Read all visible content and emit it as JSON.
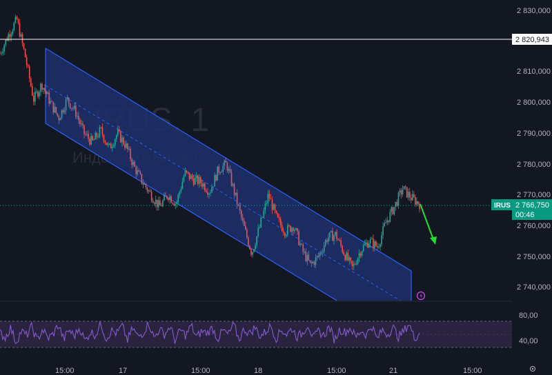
{
  "watermark": {
    "symbol_text": "IRUS, 1",
    "name_text": "ИндексМосБиржи"
  },
  "colors": {
    "background": "#131722",
    "up": "#26a69a",
    "down": "#ef5350",
    "channel_fill": "#1e2f6b",
    "channel_line": "#2962ff",
    "arrow": "#22e032",
    "rsi_line": "#7e57c2",
    "rsi_band": "#2a2340",
    "price_tag": "#089981",
    "level_line": "#ffffff",
    "text": "#b2b5be"
  },
  "chart_data": [
    {
      "type": "candlestick",
      "title": "",
      "ylim": [
        2734000,
        2833000
      ],
      "y_ticks": [
        "2 830,000",
        "2 810,000",
        "2 800,000",
        "2 790,000",
        "2 780,000",
        "2 770,000",
        "2 760,000",
        "2 750,000",
        "2 740,000"
      ],
      "x_ticks": [
        "15:00",
        "17",
        "15:00",
        "18",
        "15:00",
        "21",
        "15:00"
      ],
      "horizontal_level": {
        "value": 2820943,
        "label": "2 820,943"
      },
      "current_price": {
        "symbol": "IRUS",
        "value_label": "2 766,750",
        "countdown": "00:46",
        "value": 2766750
      },
      "grid": false,
      "descending_channel": {
        "start_session": "16 15:00",
        "end_session": "21",
        "upper_start": 2817000,
        "upper_end": 2745000,
        "lower_start": 2793000,
        "lower_end": 2720000
      },
      "price_path": [
        [
          0,
          2816000
        ],
        [
          1,
          2822000
        ],
        [
          2,
          2827000
        ],
        [
          3,
          2815000
        ],
        [
          4,
          2801000
        ],
        [
          5,
          2806000
        ],
        [
          6,
          2800000
        ],
        [
          7,
          2795000
        ],
        [
          8,
          2801000
        ],
        [
          9,
          2797000
        ],
        [
          10,
          2790000
        ],
        [
          11,
          2787000
        ],
        [
          12,
          2791000
        ],
        [
          13,
          2785000
        ],
        [
          14,
          2790000
        ],
        [
          15,
          2786000
        ],
        [
          16,
          2779000
        ],
        [
          17,
          2774000
        ],
        [
          18,
          2770000
        ],
        [
          19,
          2766000
        ],
        [
          20,
          2770000
        ],
        [
          21,
          2767000
        ],
        [
          22,
          2777000
        ],
        [
          23,
          2775000
        ],
        [
          24,
          2774000
        ],
        [
          25,
          2771000
        ],
        [
          26,
          2778000
        ],
        [
          27,
          2780000
        ],
        [
          28,
          2770000
        ],
        [
          29,
          2760000
        ],
        [
          30,
          2751000
        ],
        [
          31,
          2760000
        ],
        [
          32,
          2770000
        ],
        [
          33,
          2762000
        ],
        [
          34,
          2758000
        ],
        [
          35,
          2760000
        ],
        [
          36,
          2752000
        ],
        [
          37,
          2747000
        ],
        [
          38,
          2750000
        ],
        [
          39,
          2756000
        ],
        [
          40,
          2757000
        ],
        [
          41,
          2751000
        ],
        [
          42,
          2746000
        ],
        [
          43,
          2752000
        ],
        [
          44,
          2755000
        ],
        [
          45,
          2753000
        ],
        [
          46,
          2761000
        ],
        [
          47,
          2766000
        ],
        [
          48,
          2772000
        ],
        [
          49,
          2769000
        ],
        [
          50,
          2767000
        ]
      ]
    },
    {
      "type": "line",
      "title": "",
      "ylim": [
        30,
        90
      ],
      "y_ticks": [
        "80,00",
        "40,00"
      ],
      "band": [
        30,
        70
      ],
      "midline": 50,
      "series": [
        {
          "values": [
            52,
            45,
            60,
            38,
            55,
            48,
            62,
            40,
            58,
            44,
            50,
            65,
            42,
            57,
            47,
            61,
            39,
            54,
            49,
            66,
            43,
            56,
            51,
            63,
            41,
            59,
            46,
            53,
            68,
            44,
            58,
            50,
            62,
            40,
            57,
            48,
            64,
            45,
            55,
            52,
            60,
            43,
            56,
            49,
            65,
            42,
            58,
            51,
            61,
            47,
            54,
            63,
            44,
            57,
            50,
            59,
            46,
            52,
            66,
            43,
            55,
            48,
            62,
            41,
            58,
            53,
            60,
            45,
            56,
            49,
            64,
            42,
            57,
            50,
            61,
            46,
            54,
            67,
            44,
            52
          ]
        }
      ]
    }
  ]
}
